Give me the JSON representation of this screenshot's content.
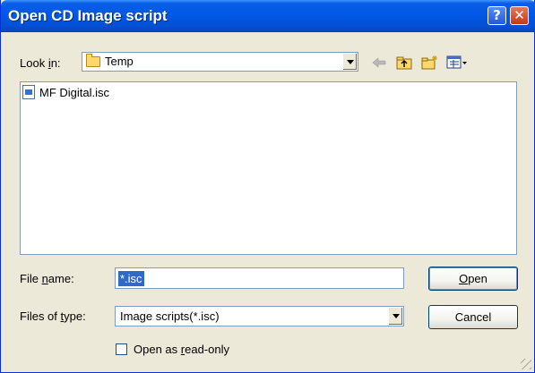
{
  "window": {
    "title": "Open CD Image script",
    "help_label": "?",
    "close_label": "✕"
  },
  "lookin": {
    "label_pre": "Look ",
    "label_mnemonic": "i",
    "label_post": "n:",
    "value": "Temp",
    "folder_icon": "folder-icon"
  },
  "toolbar": {
    "icons": [
      "back-arrow-icon",
      "up-folder-icon",
      "new-folder-icon",
      "view-menu-icon"
    ]
  },
  "files": [
    {
      "name": "MF Digital.isc",
      "icon": "script-file-icon"
    }
  ],
  "filename": {
    "label_pre": "File ",
    "label_mnemonic": "n",
    "label_post": "ame:",
    "value": "*.isc"
  },
  "filetype": {
    "label_pre": "Files of ",
    "label_mnemonic": "t",
    "label_post": "ype:",
    "value": "Image scripts(*.isc)"
  },
  "buttons": {
    "open_mnemonic": "O",
    "open_rest": "pen",
    "cancel": "Cancel"
  },
  "readonly": {
    "label_pre": "Open as ",
    "label_mnemonic": "r",
    "label_post": "ead-only",
    "checked": false
  },
  "colors": {
    "titlebar": "#0058e6",
    "dialog_bg": "#ece9d8",
    "selection": "#316ac5"
  }
}
